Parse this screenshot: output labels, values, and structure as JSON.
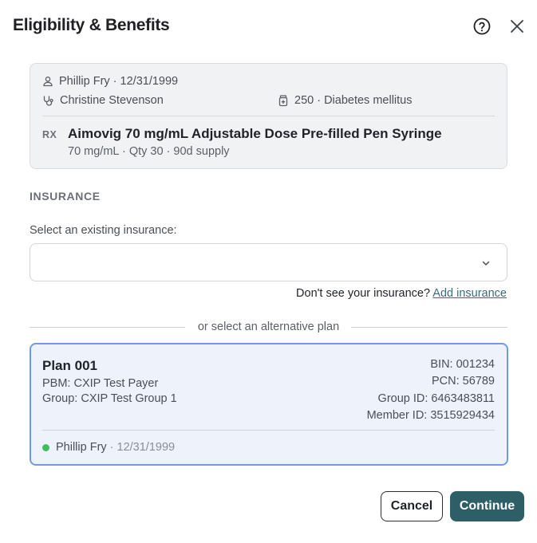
{
  "dialog": {
    "title": "Eligibility & Benefits",
    "help_icon": "question-circle-icon",
    "close_icon": "close-icon"
  },
  "prescription": {
    "patient": "Phillip Fry · 12/31/1999",
    "prescriber": "Christine Stevenson",
    "diagnosis": "250 · Diabetes mellitus",
    "rx_tag": "RX",
    "drug_name": "Aimovig 70 mg/mL Adjustable Dose Pre-filled Pen Syringe",
    "drug_detail": "70 mg/mL · Qty 30 · 90d supply",
    "icons": {
      "patient": "person-icon",
      "prescriber": "stethoscope-icon",
      "diagnosis": "medical-bottle-icon"
    }
  },
  "insurance": {
    "section_label": "INSURANCE",
    "select_label": "Select an existing insurance:",
    "select_value": "",
    "missing_prompt": "Don't see your insurance?",
    "add_link": "Add insurance",
    "alt_divider": "or select an alternative plan"
  },
  "plan": {
    "name": "Plan 001",
    "pbm": "PBM: CXIP Test Payer",
    "group": "Group: CXIP Test Group 1",
    "bin": "BIN: 001234",
    "pcn": "PCN: 56789",
    "group_id": "Group ID: 6463483811",
    "member_id": "Member ID: 3515929434",
    "patient_name": "Phillip Fry",
    "patient_dob": "· 12/31/1999",
    "status_color": "#3fbf5a",
    "selected": true
  },
  "actions": {
    "cancel": "Cancel",
    "continue": "Continue"
  },
  "colors": {
    "primary": "#2e5f66",
    "selected_border": "#6d9be6",
    "link": "#3c6b78"
  }
}
